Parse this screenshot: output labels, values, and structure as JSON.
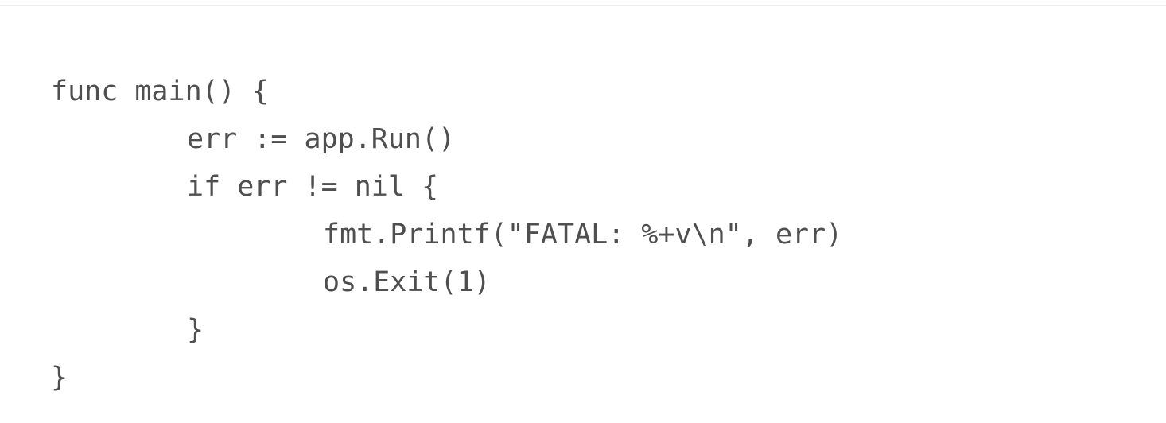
{
  "code": {
    "lines": [
      "func main() {",
      "err := app.Run()",
      "if err != nil {",
      "fmt.Printf(\"FATAL: %+v\\n\", err)",
      "os.Exit(1)",
      "}",
      "}"
    ]
  }
}
